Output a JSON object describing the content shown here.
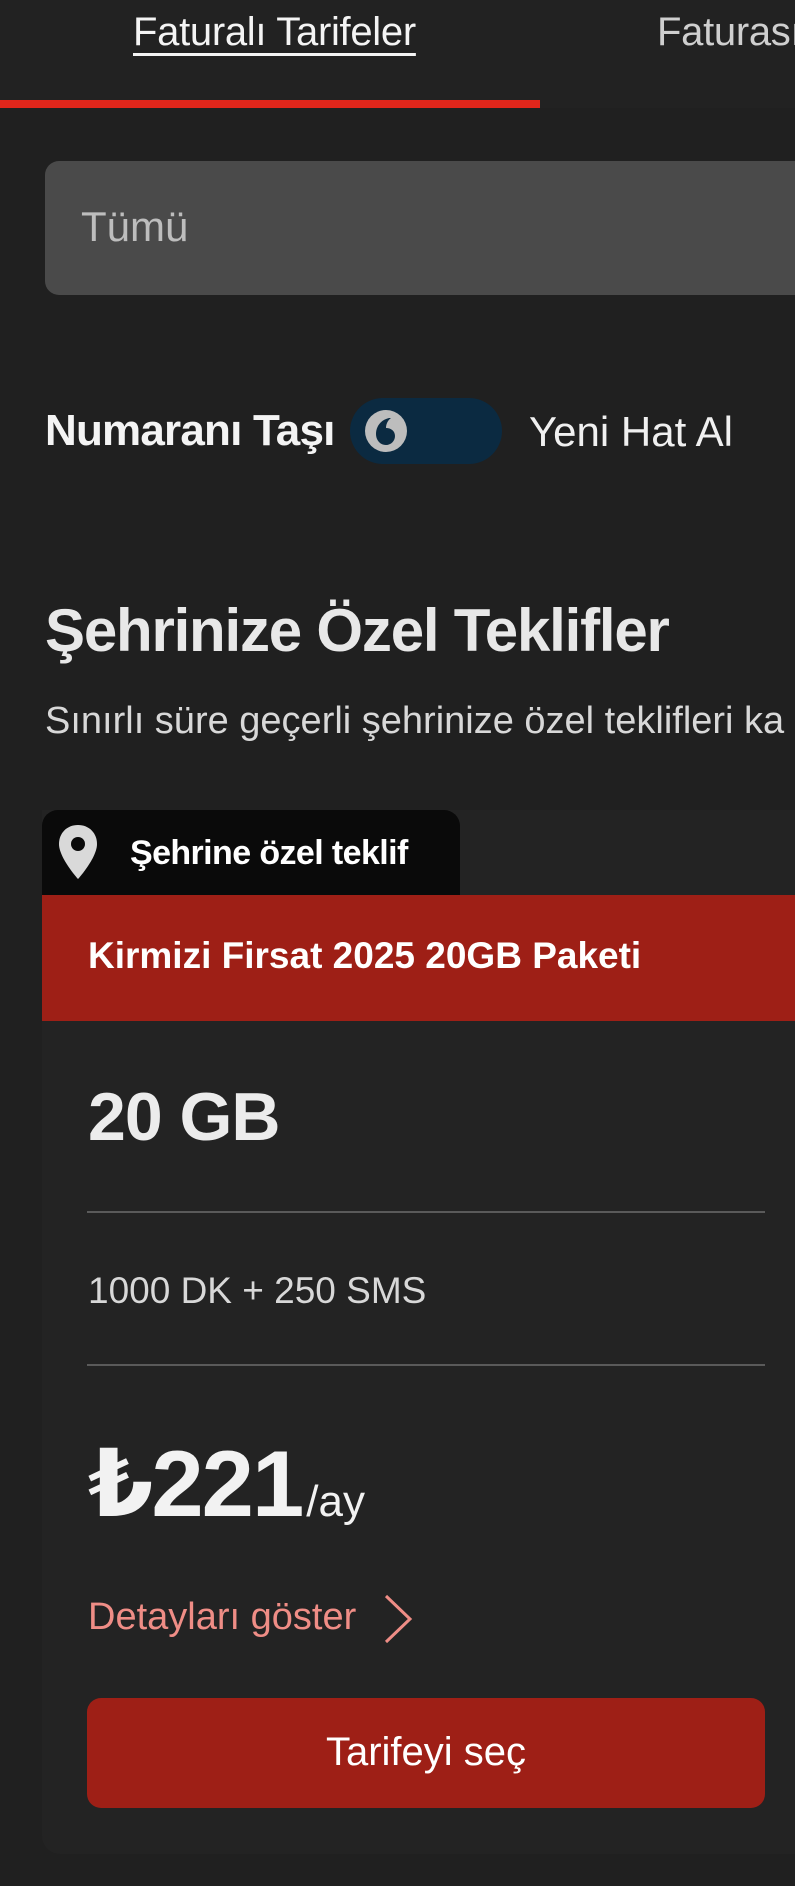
{
  "tabs": {
    "active": "Faturalı Tarifeler",
    "inactive": "Faturasız"
  },
  "filter": {
    "selected": "Tümü"
  },
  "toggle": {
    "left_label": "Numaranı Taşı",
    "right_label": "Yeni Hat Al"
  },
  "section": {
    "title": "Şehrinize Özel Teklifler",
    "subtitle": "Sınırlı süre geçerli şehrinize özel teklifleri ka"
  },
  "card": {
    "tag": "Şehrine özel teklif",
    "name": "Kirmizi Firsat 2025 20GB Paketi",
    "data": "20 GB",
    "minutes_sms": "1000 DK + 250 SMS",
    "price": "₺221",
    "period": "/ay",
    "details_link": "Detayları göster",
    "select_button": "Tarifeyi seç"
  },
  "colors": {
    "accent_red": "#e0261b",
    "brand_dark_red": "#9e1f16",
    "link_color": "#ef8d86",
    "toggle_track": "#0b2a41"
  }
}
